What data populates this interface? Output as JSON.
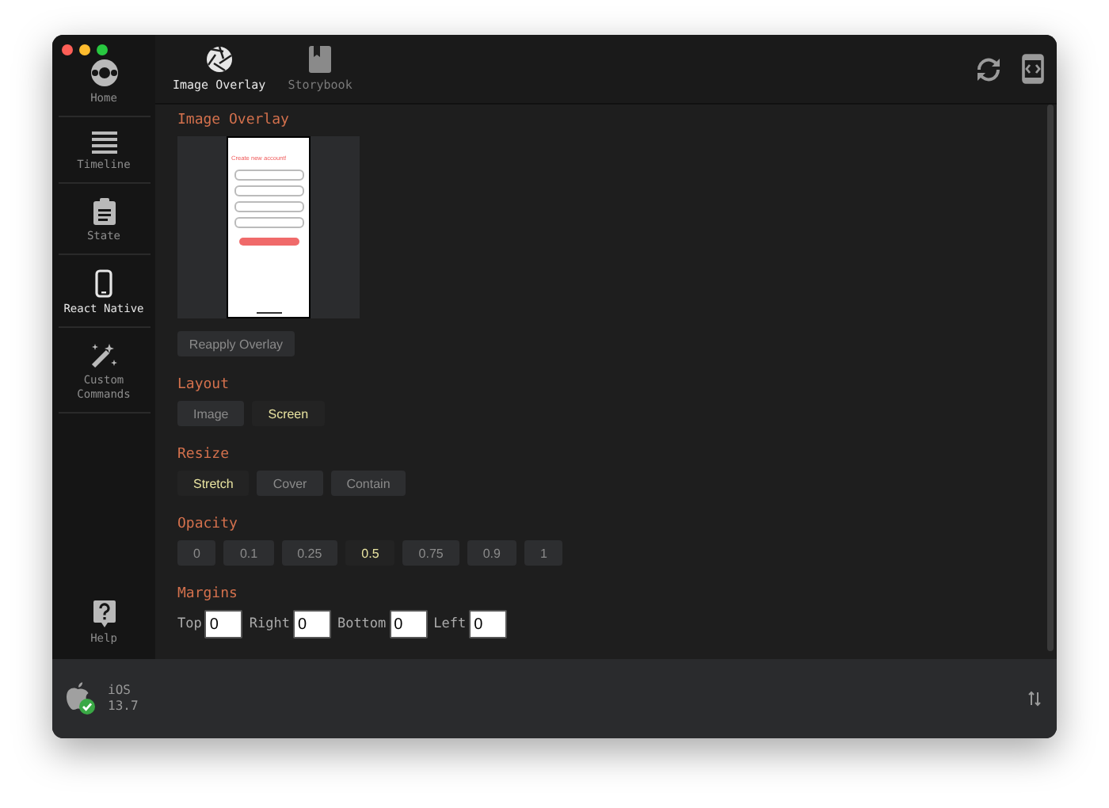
{
  "sidebar": {
    "items": [
      {
        "label": "Home",
        "kind": "home",
        "selected": false
      },
      {
        "label": "Timeline",
        "kind": "timeline",
        "selected": false
      },
      {
        "label": "State",
        "kind": "state",
        "selected": false
      },
      {
        "label": "React Native",
        "kind": "device",
        "selected": true
      },
      {
        "label": "Custom Commands",
        "kind": "commands",
        "selected": false
      }
    ],
    "help": {
      "label": "Help"
    }
  },
  "tabs": [
    {
      "label": "Image Overlay",
      "kind": "overlay",
      "selected": true
    },
    {
      "label": "Storybook",
      "kind": "storybook",
      "selected": false
    }
  ],
  "overlay": {
    "title": "Image Overlay",
    "preview": {
      "heading": "Create new account!"
    },
    "reapply_button": "Reapply Overlay"
  },
  "groups": [
    {
      "title": "Layout",
      "options": [
        {
          "label": "Image",
          "selected": false
        },
        {
          "label": "Screen",
          "selected": true
        }
      ]
    },
    {
      "title": "Resize",
      "options": [
        {
          "label": "Stretch",
          "selected": true
        },
        {
          "label": "Cover",
          "selected": false
        },
        {
          "label": "Contain",
          "selected": false
        }
      ]
    },
    {
      "title": "Opacity",
      "options": [
        {
          "label": "0",
          "selected": false
        },
        {
          "label": "0.1",
          "selected": false
        },
        {
          "label": "0.25",
          "selected": false
        },
        {
          "label": "0.5",
          "selected": true
        },
        {
          "label": "0.75",
          "selected": false
        },
        {
          "label": "0.9",
          "selected": false
        },
        {
          "label": "1",
          "selected": false
        }
      ]
    }
  ],
  "margins": {
    "title": "Margins",
    "fields": [
      {
        "label": "Top",
        "value": "0"
      },
      {
        "label": "Right",
        "value": "0"
      },
      {
        "label": "Bottom",
        "value": "0"
      },
      {
        "label": "Left",
        "value": "0"
      }
    ]
  },
  "status_bar": {
    "platform": "iOS",
    "version": "13.7",
    "connected": true
  }
}
